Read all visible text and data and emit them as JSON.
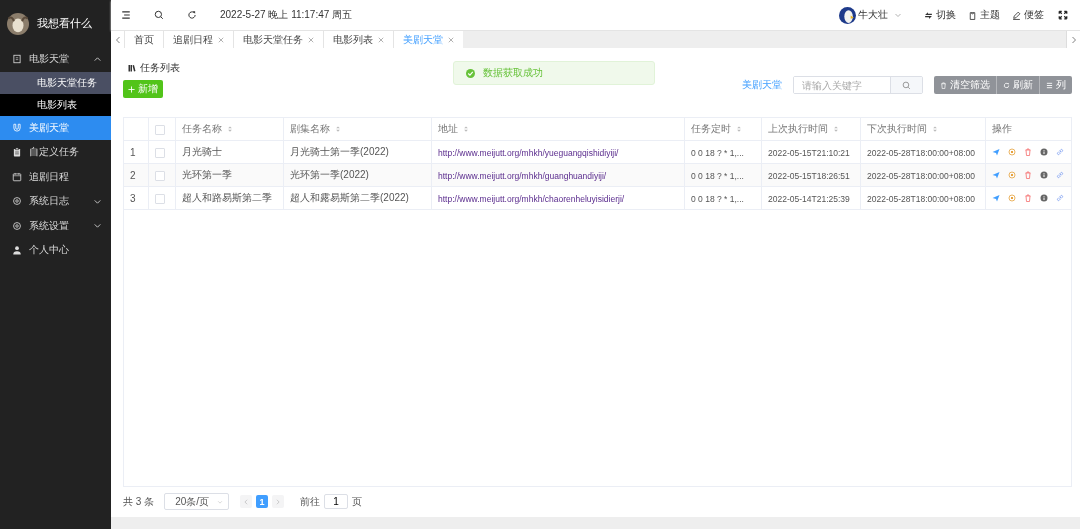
{
  "sidebar": {
    "title": "我想看什么",
    "items": [
      {
        "label": "电影天堂",
        "expandable": true,
        "expanded": true,
        "selected": false,
        "children": [
          {
            "label": "电影天堂任务",
            "selected": true
          },
          {
            "label": "电影列表",
            "selected": false
          }
        ]
      },
      {
        "label": "美剧天堂",
        "expandable": false,
        "selected": true
      },
      {
        "label": "自定义任务",
        "expandable": false,
        "selected": false
      },
      {
        "label": "追剧日程",
        "expandable": false,
        "selected": false
      },
      {
        "label": "系统日志",
        "expandable": true,
        "expanded": false,
        "selected": false
      },
      {
        "label": "系统设置",
        "expandable": true,
        "expanded": false,
        "selected": false
      },
      {
        "label": "个人中心",
        "expandable": false,
        "selected": false
      }
    ]
  },
  "header": {
    "datetime": "2022-5-27 晚上 11:17:47 周五",
    "user": "牛大壮",
    "actions": [
      "切换",
      "主题",
      "便签"
    ]
  },
  "tabs": [
    {
      "label": "首页",
      "closable": false,
      "selected": false
    },
    {
      "label": "追剧日程",
      "closable": true,
      "selected": false
    },
    {
      "label": "电影天堂任务",
      "closable": true,
      "selected": false
    },
    {
      "label": "电影列表",
      "closable": true,
      "selected": false
    },
    {
      "label": "美剧天堂",
      "closable": true,
      "selected": true
    }
  ],
  "page_title": "任务列表",
  "toast": "数据获取成功",
  "add_button": "新增",
  "toolbar": {
    "link": "美剧天堂",
    "search": {
      "placeholder": "请输入关键字"
    },
    "buttons": [
      "清空筛选",
      "刷新",
      "列"
    ]
  },
  "table": {
    "select_all_checked": false,
    "columns": [
      "任务名称",
      "剧集名称",
      "地址",
      "任务定时",
      "上次执行时间",
      "下次执行时间",
      "操作"
    ],
    "rows": [
      {
        "index": "1",
        "checked": false,
        "name": "月光骑士",
        "series": "月光骑士第一季(2022)",
        "url": "http://www.meijutt.org/mhkh/yueguangqishidiyiji/",
        "cron": "0 0 18 ? * 1,...",
        "last": "2022-05-15T21:10:21",
        "next": "2022-05-28T18:00:00+08:00"
      },
      {
        "index": "2",
        "checked": false,
        "name": "光环第一季",
        "series": "光环第一季(2022)",
        "url": "http://www.meijutt.org/mhkh/guanghuandiyiji/",
        "cron": "0 0 18 ? * 1,...",
        "last": "2022-05-15T18:26:51",
        "next": "2022-05-28T18:00:00+08:00"
      },
      {
        "index": "3",
        "checked": false,
        "name": "超人和路易斯第二季",
        "series": "超人和露易斯第二季(2022)",
        "url": "http://www.meijutt.org/mhkh/chaorenheluyisidierji/",
        "cron": "0 0 18 ? * 1,...",
        "last": "2022-05-14T21:25:39",
        "next": "2022-05-28T18:00:00+08:00"
      }
    ]
  },
  "pagination": {
    "total": "共 3 条",
    "page_size": "20条/页",
    "pages": [
      {
        "label": "1",
        "selected": true
      }
    ],
    "goto_label": "前往",
    "goto_value": "1",
    "goto_suffix": "页"
  }
}
